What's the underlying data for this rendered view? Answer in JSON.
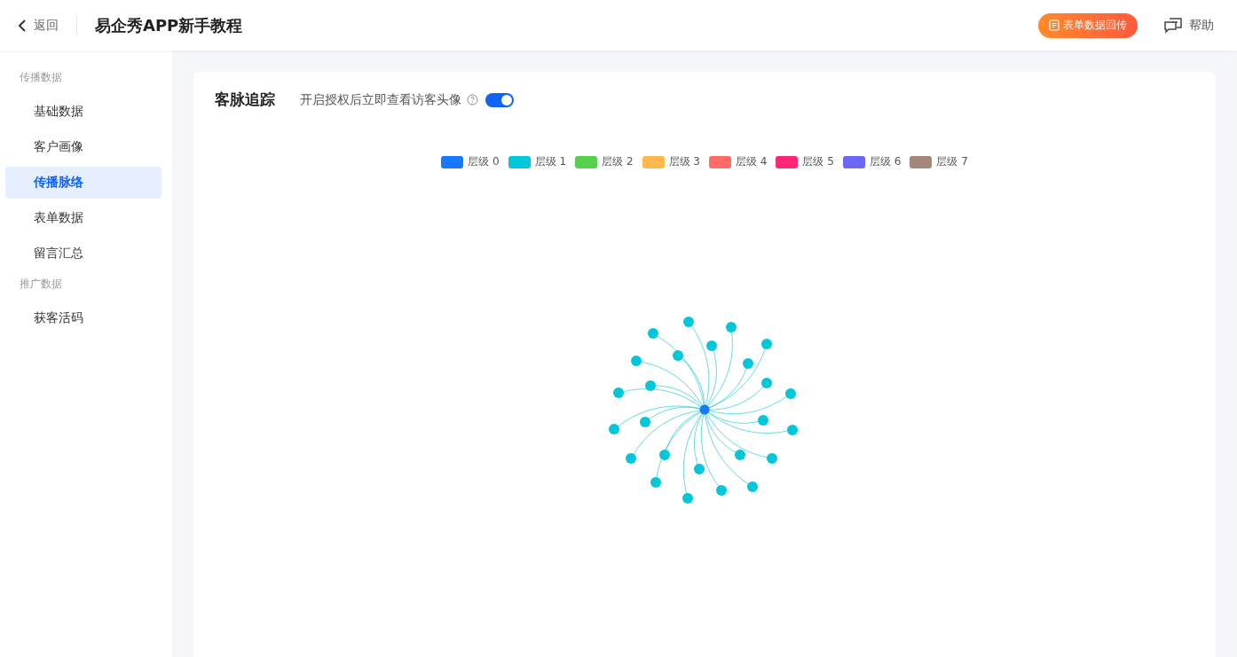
{
  "header": {
    "back": "返回",
    "title": "易企秀APP新手教程",
    "form_button": "表单数据回传",
    "help": "帮助"
  },
  "sidebar": {
    "groups": [
      {
        "title": "传播数据",
        "items": [
          {
            "label": "基础数据",
            "selected": false
          },
          {
            "label": "客户画像",
            "selected": false
          },
          {
            "label": "传播脉络",
            "selected": true
          },
          {
            "label": "表单数据",
            "selected": false
          },
          {
            "label": "留言汇总",
            "selected": false
          }
        ]
      },
      {
        "title": "推广数据",
        "items": [
          {
            "label": "获客活码",
            "selected": false
          }
        ]
      }
    ]
  },
  "card": {
    "title": "客脉追踪",
    "toggle": {
      "label": "开启授权后立即查看访客头像",
      "on": true
    },
    "legend": [
      {
        "label": "层级 0",
        "color": "#1677ff"
      },
      {
        "label": "层级 1",
        "color": "#00c7d9"
      },
      {
        "label": "层级 2",
        "color": "#57d14d"
      },
      {
        "label": "层级 3",
        "color": "#ffb84d"
      },
      {
        "label": "层级 4",
        "color": "#ff6b66"
      },
      {
        "label": "层级 5",
        "color": "#ff2677"
      },
      {
        "label": "层级 6",
        "color": "#6b66f5"
      },
      {
        "label": "层级 7",
        "color": "#a6867a"
      }
    ]
  }
}
